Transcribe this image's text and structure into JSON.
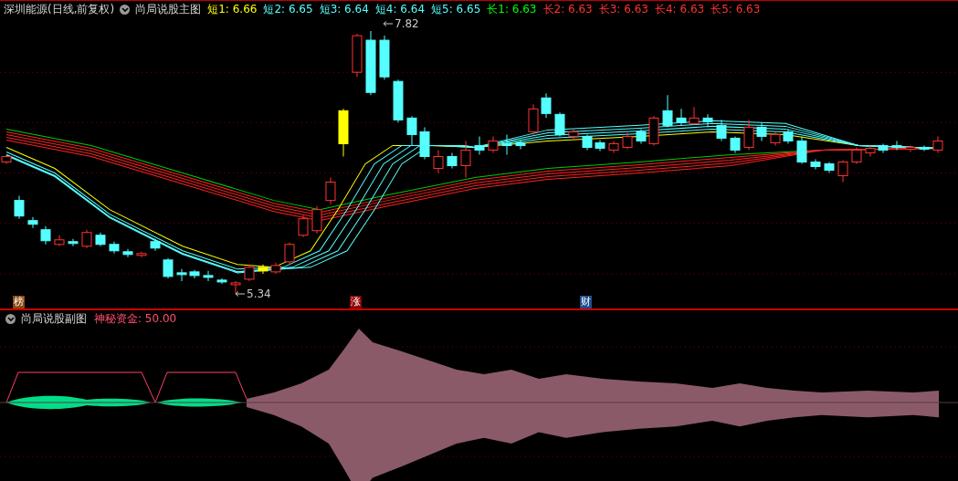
{
  "header": {
    "title": "深圳能源(日线,前复权)",
    "indicator": "尚局说股主图",
    "legend": [
      {
        "label": "短1: 6.66",
        "color": "#ffff00"
      },
      {
        "label": "短2: 6.65",
        "color": "#55ffff"
      },
      {
        "label": "短3: 6.64",
        "color": "#55ffff"
      },
      {
        "label": "短4: 6.64",
        "color": "#55ffff"
      },
      {
        "label": "短5: 6.65",
        "color": "#55ffff"
      },
      {
        "label": "长1: 6.63",
        "color": "#00ff00"
      },
      {
        "label": "长2: 6.63",
        "color": "#ff3232"
      },
      {
        "label": "长3: 6.63",
        "color": "#ff3232"
      },
      {
        "label": "长4: 6.63",
        "color": "#ff3232"
      },
      {
        "label": "长5: 6.63",
        "color": "#ff3232"
      }
    ]
  },
  "main_chart": {
    "price_labels": [
      {
        "text": "7.82"
      },
      {
        "text": "5.34"
      }
    ],
    "markers": [
      {
        "text": "榜",
        "color": "#8b4a10"
      },
      {
        "text": "涨",
        "color": "#8b0000"
      },
      {
        "text": "财",
        "color": "#1e4e8c"
      }
    ]
  },
  "sub_panel": {
    "indicator": "尚局说股副图",
    "reading": "神秘资金: 50.00"
  }
}
